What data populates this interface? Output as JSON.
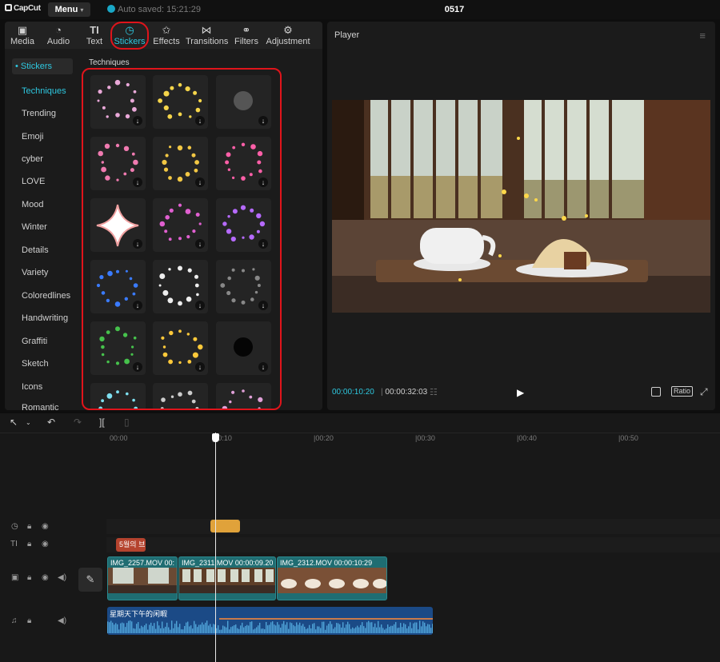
{
  "titlebar": {
    "logo": "CapCut",
    "menu_label": "Menu",
    "autosave": "Auto saved: 15:21:29",
    "project_title": "0517"
  },
  "toolbar": {
    "tabs": [
      {
        "label": "Media",
        "icon": "media-icon"
      },
      {
        "label": "Audio",
        "icon": "audio-icon"
      },
      {
        "label": "Text",
        "icon": "text-icon"
      },
      {
        "label": "Stickers",
        "icon": "stickers-icon",
        "active": true
      },
      {
        "label": "Effects",
        "icon": "effects-icon"
      },
      {
        "label": "Transitions",
        "icon": "transitions-icon"
      },
      {
        "label": "Filters",
        "icon": "filters-icon"
      },
      {
        "label": "Adjustment",
        "icon": "adjustment-icon"
      }
    ]
  },
  "categories": {
    "header": "• Stickers",
    "items": [
      "Techniques",
      "Trending",
      "Emoji",
      "cyber",
      "LOVE",
      "Mood",
      "Winter",
      "Details",
      "Variety",
      "Coloredlines",
      "Handwriting",
      "Graffiti",
      "Sketch",
      "Icons",
      "Romantic"
    ],
    "active": "Techniques"
  },
  "stickers": {
    "section_title": "Techniques",
    "items": [
      {
        "name": "sticker-scattered-confetti",
        "color": "#e9a8d8"
      },
      {
        "name": "sticker-gold-star-ring",
        "color": "#f5d54a"
      },
      {
        "name": "sticker-silver-burst",
        "color": "#bbbbbb"
      },
      {
        "name": "sticker-pink-darling",
        "color": "#f07ab0"
      },
      {
        "name": "sticker-gold-sparkles",
        "color": "#f2c744"
      },
      {
        "name": "sticker-pink-hearts",
        "color": "#ff5fa8"
      },
      {
        "name": "sticker-white-star-flash",
        "color": "#ffffff"
      },
      {
        "name": "sticker-magenta-hearts",
        "color": "#e05fd0"
      },
      {
        "name": "sticker-purple-hearts",
        "color": "#b66aff"
      },
      {
        "name": "sticker-blue-hearts",
        "color": "#3a7bff"
      },
      {
        "name": "sticker-white-hearts",
        "color": "#eeeeee"
      },
      {
        "name": "sticker-grey-dust-ring",
        "color": "#888888"
      },
      {
        "name": "sticker-green-hearts",
        "color": "#46c24c"
      },
      {
        "name": "sticker-yellow-hearts",
        "color": "#ffc93a"
      },
      {
        "name": "sticker-black-smoke",
        "color": "#555555"
      },
      {
        "name": "sticker-cyan-burst",
        "color": "#7ee0f0"
      },
      {
        "name": "sticker-white-wisp",
        "color": "#cccccc"
      },
      {
        "name": "sticker-pink-burst",
        "color": "#e0a0d8"
      }
    ]
  },
  "player": {
    "title": "Player",
    "current_time": "00:00:10:20",
    "total_time": "00:00:32:03",
    "ratio_label": "Ratio"
  },
  "timeline": {
    "ruler_labels": [
      "00:00",
      "|00:10",
      "|00:20",
      "|00:30",
      "|00:40",
      "|00:50"
    ],
    "video_clips": [
      {
        "label": "IMG_2257.MOV   00:",
        "color": "#1f6d72"
      },
      {
        "label": "IMG_2311.MOV   00:00:09.20",
        "color": "#1f6d72"
      },
      {
        "label": "IMG_2312.MOV   00:00:10:29",
        "color": "#1f6d72"
      }
    ],
    "text_clip": "5월의 브",
    "audio_clip": "星期天下午的闲暇"
  },
  "colors": {
    "accent": "#2ec8e0",
    "highlight": "#e0141b",
    "sticker_clip": "#e0a23a",
    "text_clip": "#b5432e",
    "video_clip": "#1f6d72",
    "audio_clip": "#1b4a86"
  }
}
